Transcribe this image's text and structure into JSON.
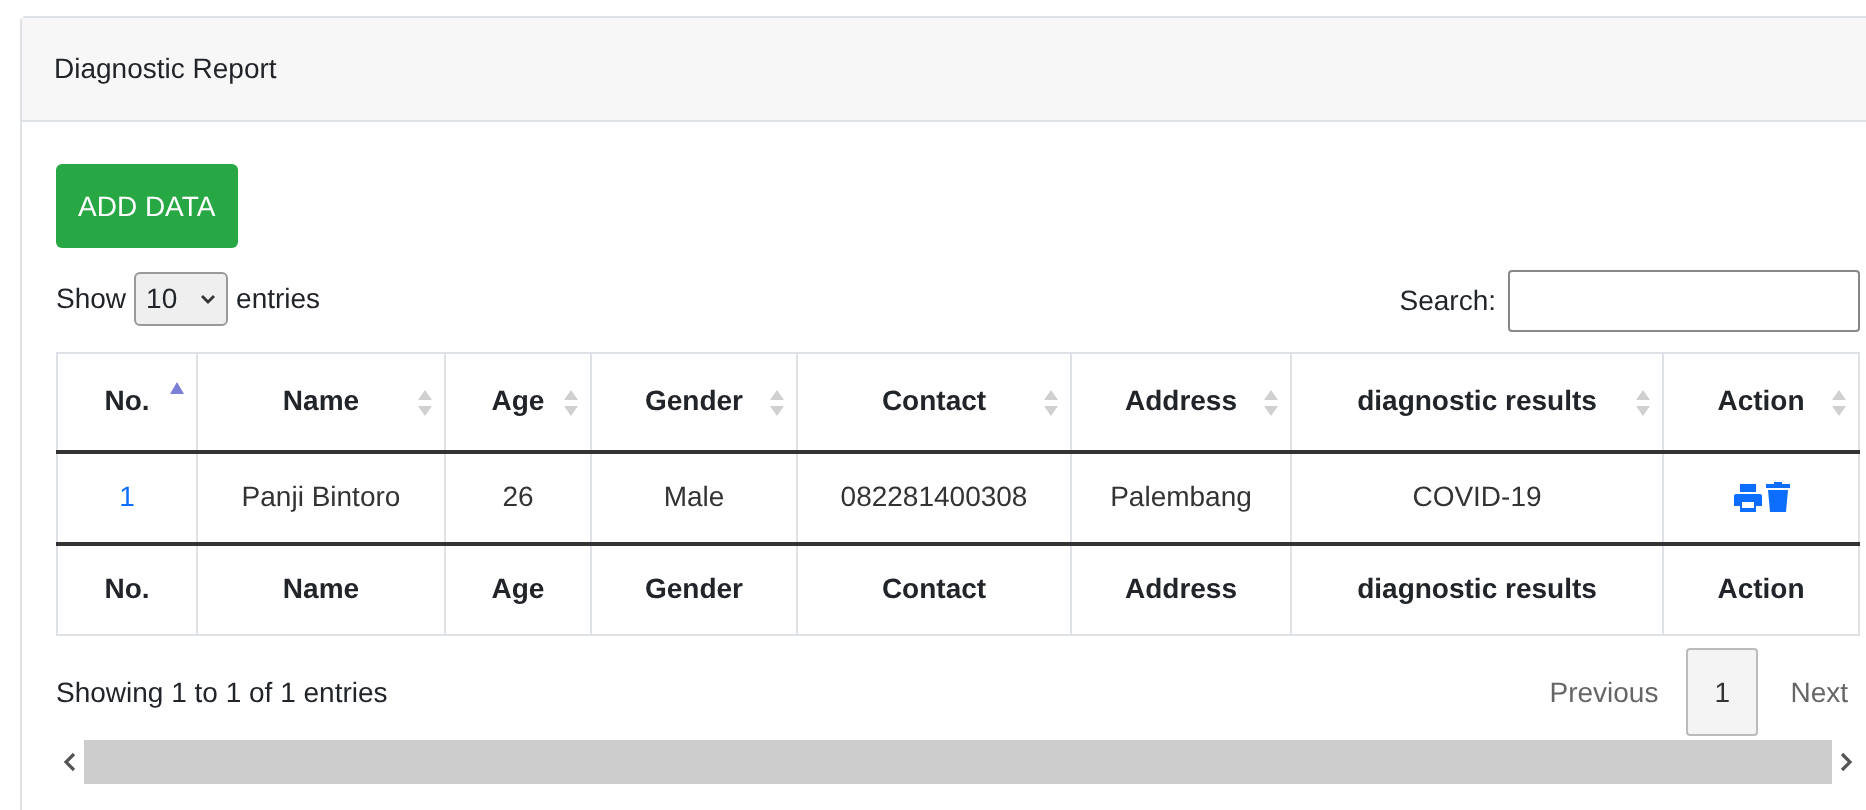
{
  "card": {
    "title": "Diagnostic Report"
  },
  "add_button": "ADD DATA",
  "length": {
    "before": "Show",
    "value": "10",
    "after": "entries"
  },
  "search": {
    "label": "Search:"
  },
  "table": {
    "columns": [
      {
        "label": "No.",
        "sorted": true
      },
      {
        "label": "Name",
        "sorted": false
      },
      {
        "label": "Age",
        "sorted": false
      },
      {
        "label": "Gender",
        "sorted": false
      },
      {
        "label": "Contact",
        "sorted": false
      },
      {
        "label": "Address",
        "sorted": false
      },
      {
        "label": "diagnostic results",
        "sorted": false
      },
      {
        "label": "Action",
        "sorted": false
      }
    ],
    "rows": [
      {
        "cells": [
          "1",
          "Panji Bintoro",
          "26",
          "Male",
          "082281400308",
          "Palembang",
          "COVID-19"
        ],
        "actions": [
          {
            "kind": "print"
          },
          {
            "kind": "delete"
          }
        ]
      }
    ],
    "footer": [
      "No.",
      "Name",
      "Age",
      "Gender",
      "Contact",
      "Address",
      "diagnostic results",
      "Action"
    ]
  },
  "info": "Showing 1 to 1 of 1 entries",
  "pagination": {
    "previous": "Previous",
    "pages": [
      {
        "label": "1",
        "selected": true
      }
    ],
    "next": "Next"
  }
}
